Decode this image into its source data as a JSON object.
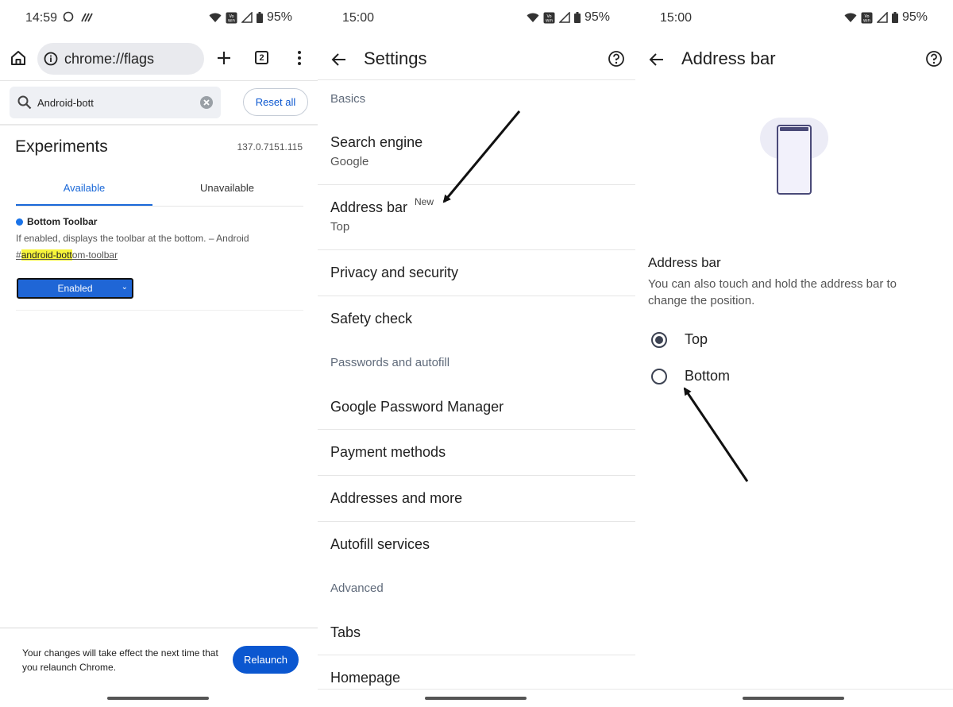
{
  "flags_screen": {
    "status": {
      "time": "14:59",
      "battery": "95%"
    },
    "url": "chrome://flags",
    "tab_count": "2",
    "search": {
      "value": "Android-bott"
    },
    "reset_all": "Reset all",
    "title": "Experiments",
    "version": "137.0.7151.115",
    "tabs": [
      "Available",
      "Unavailable"
    ],
    "flag": {
      "name": "Bottom Toolbar",
      "description": "If enabled, displays the toolbar at the bottom. – Android",
      "link_prefix": "#",
      "link_highlight": "android-bott",
      "link_rest": "om-toolbar",
      "state": "Enabled"
    },
    "relaunch": {
      "message": "Your changes will take effect the next time that you relaunch Chrome.",
      "button": "Relaunch"
    },
    "colors": {
      "accent": "#0b57d0",
      "highlight": "#f7f43b"
    }
  },
  "settings_screen": {
    "status": {
      "time": "15:00",
      "battery": "95%"
    },
    "title": "Settings",
    "sections": {
      "basics": "Basics",
      "passwords": "Passwords and autofill",
      "advanced": "Advanced"
    },
    "items": {
      "search_engine": {
        "label": "Search engine",
        "value": "Google"
      },
      "address_bar": {
        "label": "Address bar",
        "badge": "New",
        "value": "Top"
      },
      "privacy": "Privacy and security",
      "safety": "Safety check",
      "password_manager": "Google Password Manager",
      "payment": "Payment methods",
      "addresses": "Addresses and more",
      "autofill": "Autofill services",
      "tabs": "Tabs",
      "homepage": "Homepage"
    }
  },
  "address_bar_screen": {
    "status": {
      "time": "15:00",
      "battery": "95%"
    },
    "title": "Address bar",
    "heading": "Address bar",
    "description": "You can also touch and hold the address bar to change the position.",
    "options": [
      {
        "label": "Top",
        "selected": true
      },
      {
        "label": "Bottom",
        "selected": false
      }
    ]
  }
}
